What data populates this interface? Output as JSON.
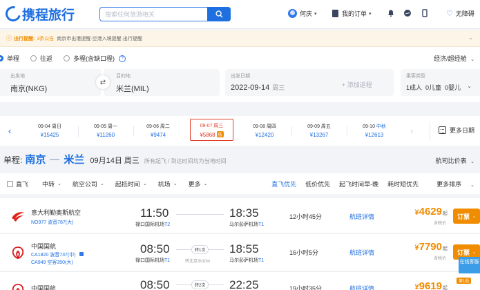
{
  "header": {
    "logo_text": "携程旅行",
    "search_placeholder": "搜索任何旅游相关",
    "user_name": "何庆",
    "orders_label": "我的订单",
    "accessibility_label": "无障碍"
  },
  "notice": {
    "title": "出行提醒:",
    "count": "3条公告",
    "text": "南京市出港提醒·空港入境提醒·出行提醒"
  },
  "search_panel": {
    "trip_types": [
      "单程",
      "往返",
      "多程(含缺口程)"
    ],
    "selected_trip_type": "单程",
    "cabin_class": "经济/超经舱",
    "from_caption": "出发地",
    "from_value": "南京(NKG)",
    "to_caption": "目的地",
    "to_value": "米兰(MIL)",
    "date_caption": "出发日期",
    "date_value": "2022-09-14",
    "date_weekday": "周三",
    "add_return_label": "+ 添加返程",
    "passenger_caption": "乘客类型",
    "passenger_value": "1成人  0儿童  0婴儿"
  },
  "date_strip": {
    "items": [
      {
        "date": "09-04",
        "weekday": "周日",
        "price": "¥15425"
      },
      {
        "date": "09-05",
        "weekday": "周一",
        "price": "¥11260"
      },
      {
        "date": "09-06",
        "weekday": "周二",
        "price": "¥9474"
      },
      {
        "date": "09-07",
        "weekday": "周三",
        "price": "¥5868",
        "tag": "低"
      },
      {
        "date": "09-08",
        "weekday": "周四",
        "price": "¥12420"
      },
      {
        "date": "09-09",
        "weekday": "周五",
        "price": "¥13267"
      },
      {
        "date": "09-10",
        "weekday": "中秋",
        "price": "¥12613"
      }
    ],
    "more_dates_label": "更多日期"
  },
  "route": {
    "kind": "单程:",
    "from": "南京",
    "to": "米兰",
    "date": "09月14日 周三",
    "note": "所有起飞 / 到达时间均为当地时间",
    "compare_label": "航司比价表"
  },
  "filters": {
    "direct_label": "直飞",
    "buttons": [
      "中转",
      "航空公司",
      "起抵时间",
      "机场",
      "更多"
    ],
    "sorts": [
      "直飞优先",
      "低价优先",
      "起飞时间早-晚",
      "耗时短优先",
      "更多排序"
    ]
  },
  "flights": [
    {
      "airline": "意大利勤奥斯航空",
      "sub1": "NO977 波音787(大)",
      "sub2": "",
      "dep_time": "11:50",
      "dep_airport": "禄口国际机场",
      "dep_terminal": "T2",
      "stop_label": "",
      "via": "",
      "arr_time": "18:35",
      "arr_airport": "马尔彭萨机场",
      "arr_terminal": "T1",
      "duration": "12小时45分",
      "detail_label": "航班详情",
      "price_number": "4629",
      "price_suffix": "起",
      "tax_note": "含税价",
      "book_label": "订票"
    },
    {
      "airline": "中国国航",
      "sub1": "CA1820 波音737(中)",
      "sub2": "CA949 空客350(大)",
      "dep_time": "08:50",
      "dep_airport": "禄口国际机场",
      "dep_terminal": "T1",
      "stop_label": "转1次",
      "via": "转北京3h10m",
      "arr_time": "18:55",
      "arr_airport": "马尔彭萨机场",
      "arr_terminal": "T1",
      "duration": "16小时5分",
      "detail_label": "航班详情",
      "price_number": "7790",
      "price_suffix": "起",
      "tax_note": "含税价",
      "book_label": "订票"
    },
    {
      "airline": "中国国航",
      "dep_time": "08:50",
      "stop_label": "转2次",
      "arr_time": "22:25",
      "duration": "19小时35分",
      "detail_label": "航班详情",
      "price_number": "9619",
      "price_suffix": "起"
    }
  ],
  "service_label": "在线客服",
  "cheap_badge": "第1低",
  "colors": {
    "brand_blue": "#1e6fe0",
    "price_orange": "#f08c00",
    "selected_red": "#e23a25"
  }
}
